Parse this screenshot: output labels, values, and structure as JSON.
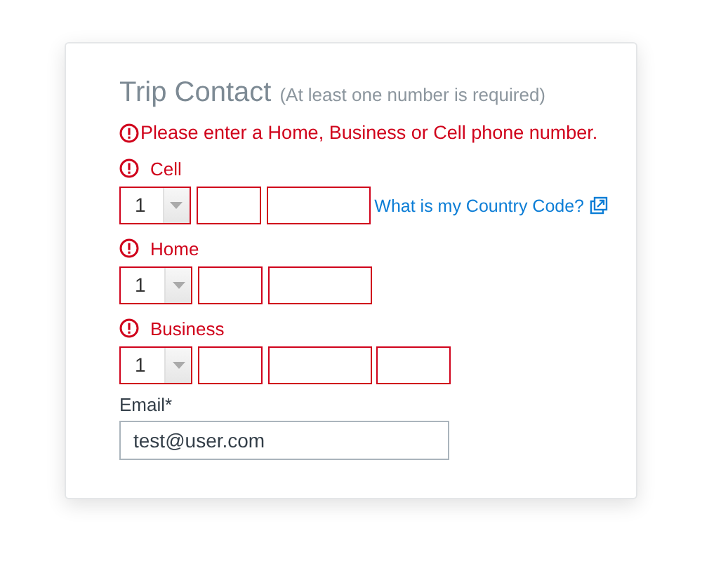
{
  "title": "Trip Contact",
  "subtitle": "(At least one number is required)",
  "error_message": "Please enter a Home, Business or Cell phone number.",
  "phones": [
    {
      "label": "Cell",
      "error": true,
      "country_code": "1",
      "extension": false,
      "link": "What is my Country Code?"
    },
    {
      "label": "Home",
      "error": true,
      "country_code": "1",
      "extension": false
    },
    {
      "label": "Business",
      "error": true,
      "country_code": "1",
      "extension": true
    }
  ],
  "email": {
    "label": "Email*",
    "value": "test@user.com"
  }
}
